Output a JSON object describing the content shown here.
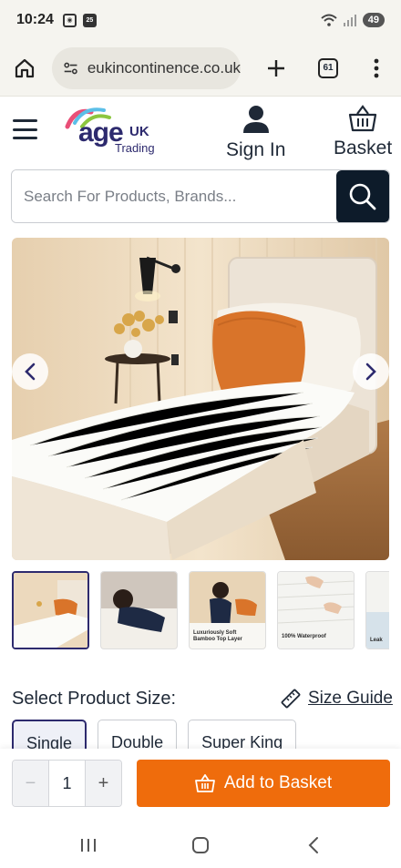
{
  "status_bar": {
    "time": "10:24",
    "icon_a": "screen-record-icon",
    "icon_b_label": "25",
    "battery": "49"
  },
  "browser": {
    "url": "eukincontinence.co.uk",
    "tab_count": "61"
  },
  "header": {
    "logo": {
      "age": "age",
      "uk": "UK",
      "trading": "Trading"
    },
    "sign_in_label": "Sign In",
    "basket_label": "Basket"
  },
  "search": {
    "placeholder": "Search For Products, Brands..."
  },
  "gallery": {
    "thumbnails": [
      {
        "caption": ""
      },
      {
        "caption": ""
      },
      {
        "caption": "Luxuriously Soft Bamboo Top Layer"
      },
      {
        "caption": "100% Waterproof"
      },
      {
        "caption": "Leak"
      }
    ]
  },
  "size": {
    "title": "Select Product Size:",
    "guide_label": "Size Guide",
    "options": [
      "Single",
      "Double",
      "Super King"
    ],
    "selected": "Single"
  },
  "cart": {
    "quantity": "1",
    "minus": "−",
    "plus": "+",
    "add_label": "Add to Basket"
  },
  "colors": {
    "brand_navy": "#2d2a6e",
    "accent_orange": "#ef6c0c",
    "search_button": "#0d1b2a"
  }
}
